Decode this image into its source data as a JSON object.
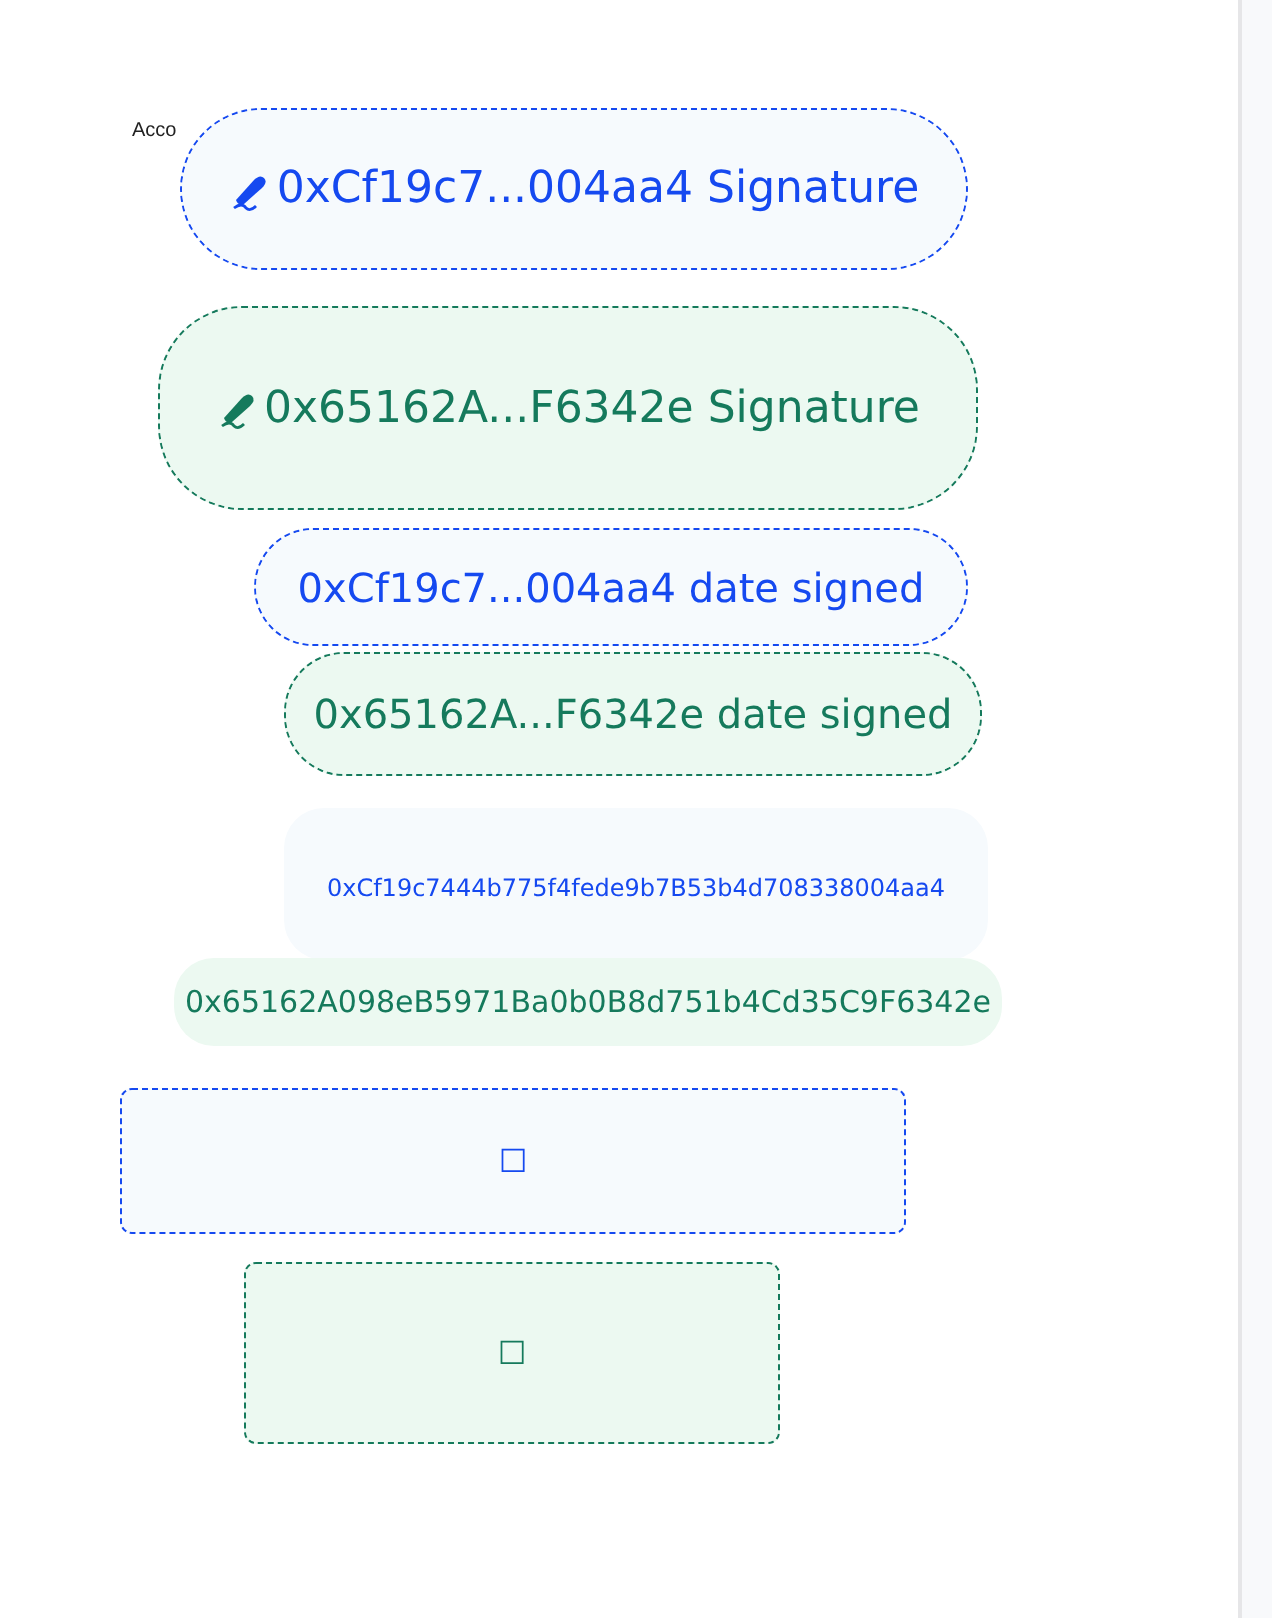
{
  "page_label": "Acco",
  "fields": [
    {
      "kind": "signature",
      "text": "0xCf19c7...004aa4 Signature",
      "color": "#1549f0"
    },
    {
      "kind": "signature",
      "text": "0x65162A...F6342e Signature",
      "color": "#157a5c"
    },
    {
      "kind": "date",
      "text": "0xCf19c7...004aa4 date signed",
      "color": "#1549f0"
    },
    {
      "kind": "date",
      "text": "0x65162A...F6342e date signed",
      "color": "#157a5c"
    },
    {
      "kind": "address",
      "text": "0xCf19c7444b775f4fede9b7B53b4d708338004aa4",
      "color": "#1549f0"
    },
    {
      "kind": "address",
      "text": "0x65162A098eB5971Ba0b0B8d751b4Cd35C9F6342e",
      "color": "#157a5c"
    },
    {
      "kind": "checkbox",
      "text": "☐",
      "color": "#1549f0"
    },
    {
      "kind": "checkbox",
      "text": "☐",
      "color": "#157a5c"
    }
  ]
}
